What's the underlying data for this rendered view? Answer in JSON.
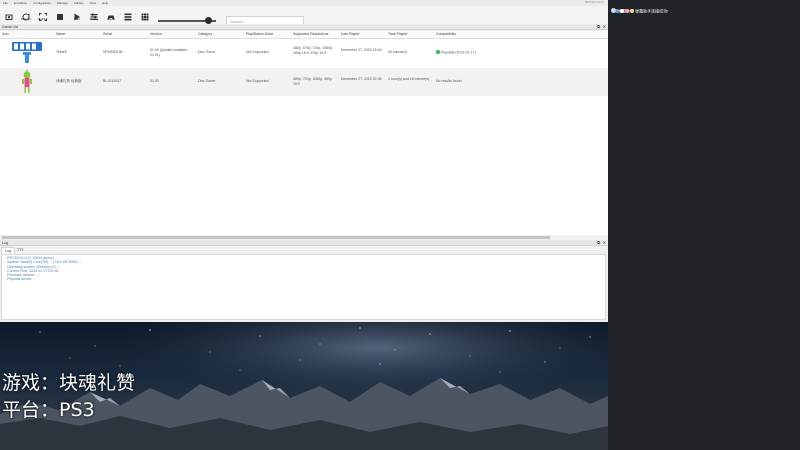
{
  "window": {
    "menu": [
      "File",
      "Emulation",
      "Configuration",
      "Manage",
      "Utilities",
      "View",
      "Help"
    ],
    "title": "RPCS3 0.0.27"
  },
  "toolbar": {
    "buttons": [
      {
        "label": "Open",
        "icon": "open-icon"
      },
      {
        "label": "Refresh",
        "icon": "refresh-icon"
      },
      {
        "label": "FullScr",
        "icon": "fullscreen-icon"
      },
      {
        "label": "Stop",
        "icon": "stop-icon"
      },
      {
        "label": "Start",
        "icon": "play-icon"
      },
      {
        "label": "Config",
        "icon": "config-icon"
      },
      {
        "label": "Pads",
        "icon": "gamepad-icon"
      },
      {
        "label": "List",
        "icon": "list-icon"
      },
      {
        "label": "Grid",
        "icon": "grid-icon"
      }
    ],
    "search_placeholder": "Search...",
    "slider_value": 0.86
  },
  "game_list": {
    "title": "Game List",
    "columns": [
      "Icon",
      "Name",
      "Serial",
      "Version",
      "Category",
      "PlayStation Move",
      "Supported Resolutions",
      "Last Played",
      "Time Played",
      "Compatibility"
    ],
    "rows": [
      {
        "name": "Tetris®",
        "serial": "NPUB30136",
        "version": "01.00 (Update available: 01.01)",
        "category": "Disc Game",
        "move": "Not Supported",
        "resolutions": "480p, 576p, 720p, 1080p, 480p 16:9, 576p 16:9",
        "last_played": "December 27, 2023 15:40",
        "time_played": "40 minute(s)",
        "compatibility": "Playable (2019-01-17)",
        "compat_color": "#27c24c"
      },
      {
        "name": "块魂礼赞 经典版",
        "serial": "BLJS10047",
        "version": "01.00",
        "category": "Disc Game",
        "move": "Not Supported",
        "resolutions": "480p, 720p, 1080p, 480p 16:9",
        "last_played": "December 27, 2023 22:28",
        "time_played": "1 hour(s) and 16 minute(s)",
        "compatibility": "No results found",
        "compat_color": ""
      }
    ]
  },
  "log": {
    "title": "Log",
    "tabs": [
      "Log",
      "TTY"
    ],
    "lines": [
      "· RPCS3 v0.0.27-15544 Alpha | ...",
      "· System: Intel(R) Core(TM) ... | 16.0 GB RAM | ...",
      "· Operating system: Windows 10 ...",
      "· Current Time: 2023-12-27T22:28",
      "· Firmware version: ...",
      "· Physical device: ..."
    ]
  },
  "stream_overlay": {
    "line1": "游戏：块魂礼赞",
    "line2": "平台：PS3"
  },
  "sidebar": {
    "notification": "弹幕助手 弹幕助手连接成功!"
  },
  "colors": {
    "log_text": "#4a7fb0",
    "sidebar_bg": "#202327"
  }
}
